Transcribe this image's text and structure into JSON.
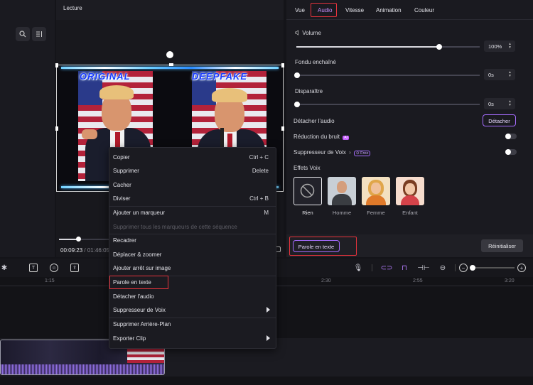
{
  "player": {
    "title": "Lecture",
    "time_current": "00:09:23",
    "time_separator": "/",
    "time_total": "01:46:05"
  },
  "preview": {
    "left_label": "ORIGINAL",
    "right_label": "DEEPFAKE"
  },
  "inspector": {
    "tabs": [
      "Vue",
      "Audio",
      "Vitesse",
      "Animation",
      "Couleur"
    ],
    "active_tab": "Audio",
    "volume": {
      "label": "Volume",
      "value_text": "100%",
      "level": 0.78
    },
    "fade_in": {
      "label": "Fondu enchaîné",
      "value_text": "0s",
      "level": 0
    },
    "fade_out": {
      "label": "Disparaître",
      "value_text": "0s",
      "level": 0
    },
    "detach": {
      "label": "Détacher l'audio",
      "button": "Détacher"
    },
    "noise": {
      "label": "Réduction du bruit",
      "badge": "AI",
      "on": false
    },
    "voice_remover": {
      "label": "Suppresseur de Voix",
      "chevron": "›",
      "badge": "Free",
      "on": false
    },
    "voice_effects": {
      "title": "Effets Voix",
      "items": [
        {
          "label": "Rien",
          "icon": "none-icon",
          "selected": true
        },
        {
          "label": "Homme",
          "icon": "man-avatar",
          "selected": false
        },
        {
          "label": "Femme",
          "icon": "woman-avatar",
          "selected": false
        },
        {
          "label": "Enfant",
          "icon": "child-avatar",
          "selected": false
        }
      ]
    },
    "speech_to_text_button": "Parole en texte",
    "reset_button": "Réinitialiser"
  },
  "timeline": {
    "ruler": [
      "1:15",
      "2:30",
      "2:55",
      "3:20"
    ]
  },
  "context_menu": {
    "items": [
      {
        "label": "Copier",
        "shortcut": "Ctrl + C"
      },
      {
        "label": "Supprimer",
        "shortcut": "Delete"
      },
      {
        "label": "Cacher",
        "shortcut": ""
      },
      {
        "label": "Diviser",
        "shortcut": "Ctrl + B"
      },
      {
        "label": "Ajouter un marqueur",
        "shortcut": "M"
      },
      {
        "label": "Supprimer tous les marqueurs de cette séquence",
        "shortcut": "",
        "disabled": true
      },
      {
        "label": "Recadrer",
        "shortcut": ""
      },
      {
        "label": "Déplacer & zoomer",
        "shortcut": ""
      },
      {
        "label": "Ajouter arrêt sur image",
        "shortcut": ""
      },
      {
        "label": "Parole en texte",
        "shortcut": "",
        "highlighted": true
      },
      {
        "label": "Détacher l'audio",
        "shortcut": ""
      },
      {
        "label": "Suppresseur de Voix",
        "shortcut": "",
        "submenu": true
      },
      {
        "label": "Supprimer Arrière-Plan",
        "shortcut": ""
      },
      {
        "label": "Exporter Clip",
        "shortcut": "",
        "submenu": true
      }
    ]
  },
  "colors": {
    "accent": "#a66cff",
    "highlight": "#e5333c"
  }
}
